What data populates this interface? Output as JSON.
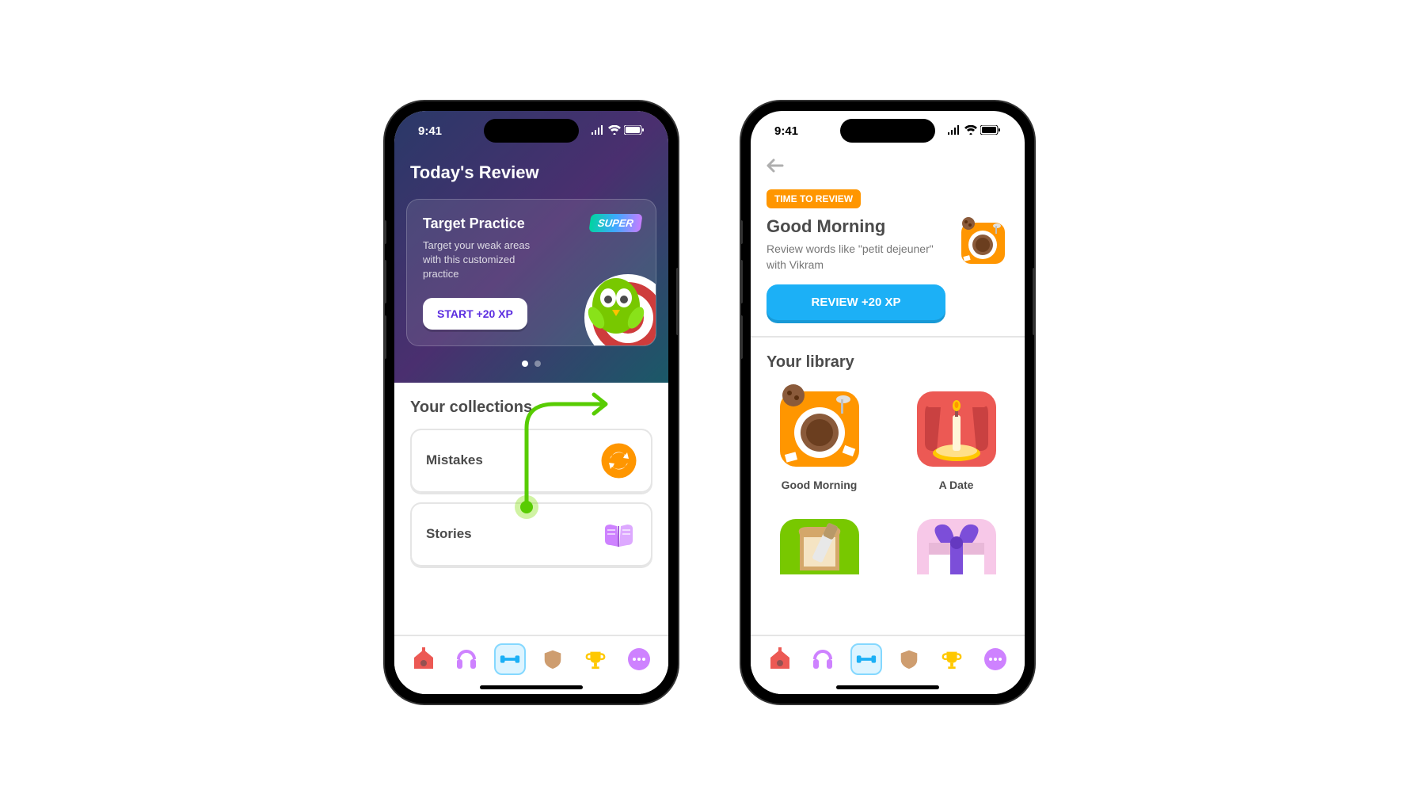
{
  "statusBar": {
    "time": "9:41"
  },
  "screen1": {
    "header": "Today's Review",
    "card": {
      "badge": "SUPER",
      "title": "Target Practice",
      "description": "Target your weak areas with this customized practice",
      "button": "START +20 XP"
    },
    "collections": {
      "title": "Your collections",
      "items": [
        {
          "name": "Mistakes"
        },
        {
          "name": "Stories"
        }
      ]
    }
  },
  "screen2": {
    "badge": "TIME TO REVIEW",
    "title": "Good Morning",
    "description": "Review words like \"petit dejeuner\" with Vikram",
    "button": "REVIEW +20 XP",
    "library": {
      "title": "Your library",
      "items": [
        {
          "name": "Good Morning"
        },
        {
          "name": "A Date"
        },
        {
          "name": ""
        },
        {
          "name": ""
        }
      ]
    }
  }
}
